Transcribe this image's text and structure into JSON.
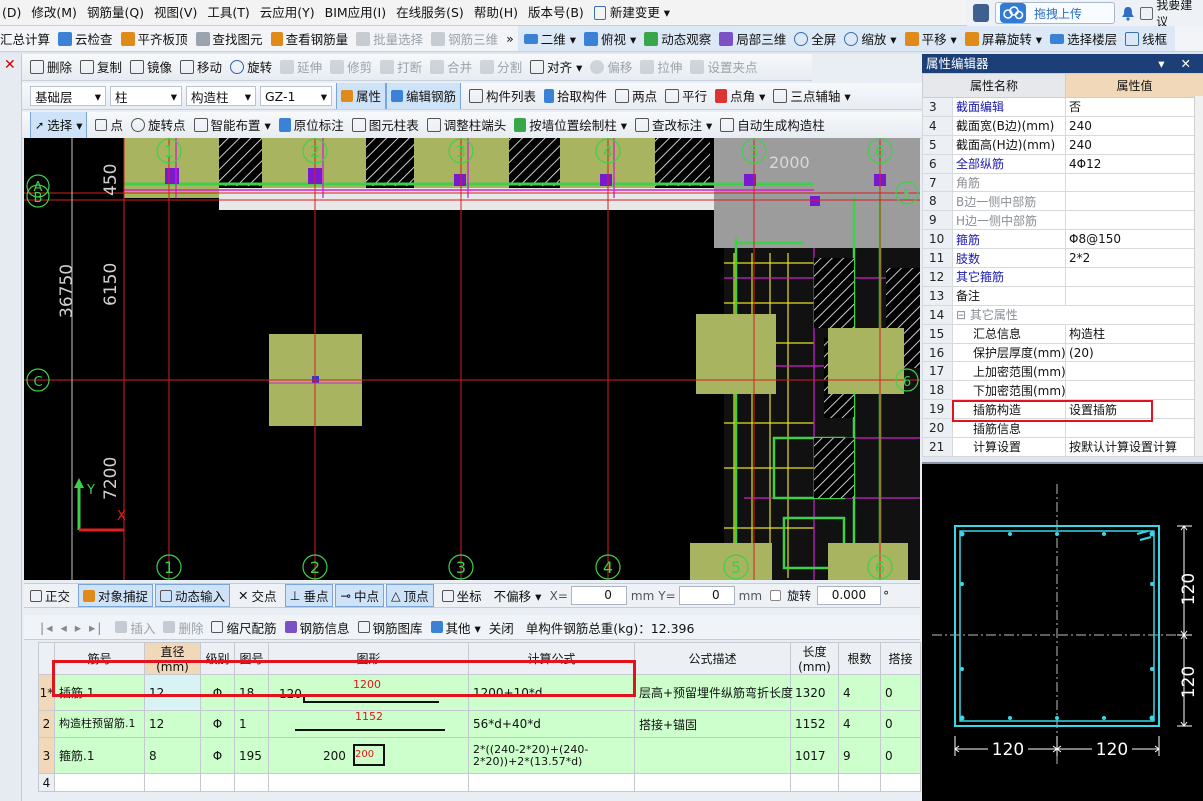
{
  "menubar": {
    "items": [
      "(D)",
      "修改(M)",
      "钢筋量(Q)",
      "视图(V)",
      "工具(T)",
      "云应用(Y)",
      "BIM应用(I)",
      "在线服务(S)",
      "帮助(H)",
      "版本号(B)",
      "新建变更 ▾"
    ],
    "upload_label": "拖拽上传",
    "suggest_label": "我要建议"
  },
  "toolbar1": {
    "left": [
      "汇总计算",
      "云检查",
      "平齐板顶",
      "查找图元",
      "查看钢筋量",
      "批量选择",
      "钢筋三维"
    ],
    "more": "»",
    "right": [
      "二维 ▾",
      "俯视 ▾",
      "动态观察",
      "局部三维",
      "全屏",
      "缩放 ▾",
      "平移 ▾",
      "屏幕旋转 ▾",
      "选择楼层",
      "线框"
    ]
  },
  "edit_toolbar": [
    "删除",
    "复制",
    "镜像",
    "移动",
    "旋转",
    "延伸",
    "修剪",
    "打断",
    "合并",
    "分割",
    "对齐 ▾",
    "偏移",
    "拉伸",
    "设置夹点"
  ],
  "selectors": {
    "floor": "基础层",
    "category": "柱",
    "type": "构造柱",
    "component": "GZ-1"
  },
  "attr_toolbar": {
    "toggles": [
      "属性",
      "编辑钢筋"
    ],
    "items": [
      "构件列表",
      "拾取构件",
      "两点",
      "平行",
      "点角 ▾",
      "三点辅轴 ▾"
    ]
  },
  "draw_toolbar": {
    "select": "选择 ▾",
    "items": [
      "点",
      "旋转点",
      "智能布置 ▾",
      "原位标注",
      "图元柱表",
      "调整柱端头",
      "按墙位置绘制柱 ▾",
      "查改标注 ▾",
      "自动生成构造柱"
    ]
  },
  "canvas": {
    "axis_top": [
      "1",
      "2",
      "3",
      "4",
      "5",
      "6"
    ],
    "axis_bottom": [
      "1",
      "2",
      "3",
      "4",
      "5",
      "6"
    ],
    "axis_left": [
      "A",
      "B",
      "C"
    ],
    "axis_right": [
      "5",
      "6"
    ],
    "dims": {
      "d1": "450",
      "d2": "6150",
      "d3": "36750",
      "d4": "7200",
      "d5": "2000"
    },
    "axis_y": "Y",
    "axis_x": "X"
  },
  "snapbar": {
    "items": [
      "正交",
      "对象捕捉",
      "动态输入",
      "交点",
      "垂点",
      "中点",
      "顶点",
      "坐标"
    ],
    "offset": "不偏移 ▾",
    "x_label": "X=",
    "x_val": "0",
    "y_label": "Y=",
    "y_val": "0",
    "unit": "mm",
    "rotate_label": "旋转",
    "rotate_val": "0.000",
    "deg": "°"
  },
  "table_toolbar": {
    "items": [
      "插入",
      "删除",
      "缩尺配筋",
      "钢筋信息",
      "钢筋图库",
      "其他 ▾",
      "关闭"
    ],
    "weight_label": "单构件钢筋总重(kg)：12.396"
  },
  "rebar_table": {
    "headers": [
      "筋号",
      "直径(mm)",
      "级别",
      "图号",
      "图形",
      "计算公式",
      "公式描述",
      "长度(mm)",
      "根数",
      "搭接"
    ],
    "rows": [
      {
        "n": "1*",
        "name": "插筋.1",
        "dia": "12",
        "grade": "Φ",
        "fig": "18",
        "shape_left": "120",
        "shape_len": "1200",
        "formula": "1200+10*d",
        "desc": "层高+预留埋件纵筋弯折长度",
        "length": "1320",
        "count": "4",
        "lap": "0"
      },
      {
        "n": "2",
        "name": "构造柱预留筋.1",
        "dia": "12",
        "grade": "Φ",
        "fig": "1",
        "shape_left": "",
        "shape_len": "1152",
        "formula": "56*d+40*d",
        "desc": "搭接+锚固",
        "length": "1152",
        "count": "4",
        "lap": "0"
      },
      {
        "n": "3",
        "name": "箍筋.1",
        "dia": "8",
        "grade": "Φ",
        "fig": "195",
        "shape_left": "200",
        "shape_len": "200",
        "formula": "2*((240-2*20)+(240-2*20))+2*(13.57*d)",
        "desc": "",
        "length": "1017",
        "count": "9",
        "lap": "0"
      },
      {
        "n": "4",
        "name": "",
        "dia": "",
        "grade": "",
        "fig": "",
        "shape_left": "",
        "shape_len": "",
        "formula": "",
        "desc": "",
        "length": "",
        "count": "",
        "lap": ""
      }
    ]
  },
  "prop_panel": {
    "title": "属性编辑器",
    "pins": "▾ ✕",
    "header_name": "属性名称",
    "header_value": "属性值",
    "rows": [
      {
        "idx": "3",
        "name": "截面编辑",
        "value": "否"
      },
      {
        "idx": "4",
        "name": "截面宽(B边)(mm)",
        "value": "240"
      },
      {
        "idx": "5",
        "name": "截面高(H边)(mm)",
        "value": "240"
      },
      {
        "idx": "6",
        "name": "全部纵筋",
        "value": "4Φ12"
      },
      {
        "idx": "7",
        "name": "角筋",
        "value": ""
      },
      {
        "idx": "8",
        "name": "B边一侧中部筋",
        "value": ""
      },
      {
        "idx": "9",
        "name": "H边一侧中部筋",
        "value": ""
      },
      {
        "idx": "10",
        "name": "箍筋",
        "value": "Φ8@150"
      },
      {
        "idx": "11",
        "name": "肢数",
        "value": "2*2"
      },
      {
        "idx": "12",
        "name": "其它箍筋",
        "value": ""
      },
      {
        "idx": "13",
        "name": "备注",
        "value": ""
      },
      {
        "idx": "14",
        "name": "⊟ 其它属性",
        "value": ""
      },
      {
        "idx": "15",
        "name": "汇总信息",
        "value": "构造柱"
      },
      {
        "idx": "16",
        "name": "保护层厚度(mm)",
        "value": "(20)"
      },
      {
        "idx": "17",
        "name": "上加密范围(mm)",
        "value": ""
      },
      {
        "idx": "18",
        "name": "下加密范围(mm)",
        "value": ""
      },
      {
        "idx": "19",
        "name": "插筋构造",
        "value": "设置插筋"
      },
      {
        "idx": "20",
        "name": "插筋信息",
        "value": ""
      },
      {
        "idx": "21",
        "name": "计算设置",
        "value": "按默认计算设置计算"
      }
    ]
  },
  "preview": {
    "dim_right_top": "120",
    "dim_right_bottom": "120",
    "dim_bottom_left": "120",
    "dim_bottom_right": "120"
  },
  "colors": {
    "canvas_bg": "#000000",
    "grid_red": "#d42020",
    "axis_green": "#3fd04a",
    "pad_olive": "#a8b460",
    "table_mint": "#ccffcc",
    "table_tan": "#f0d8b8",
    "preview_cyan": "#38d8e8",
    "highlight_red": "#e0141e"
  }
}
